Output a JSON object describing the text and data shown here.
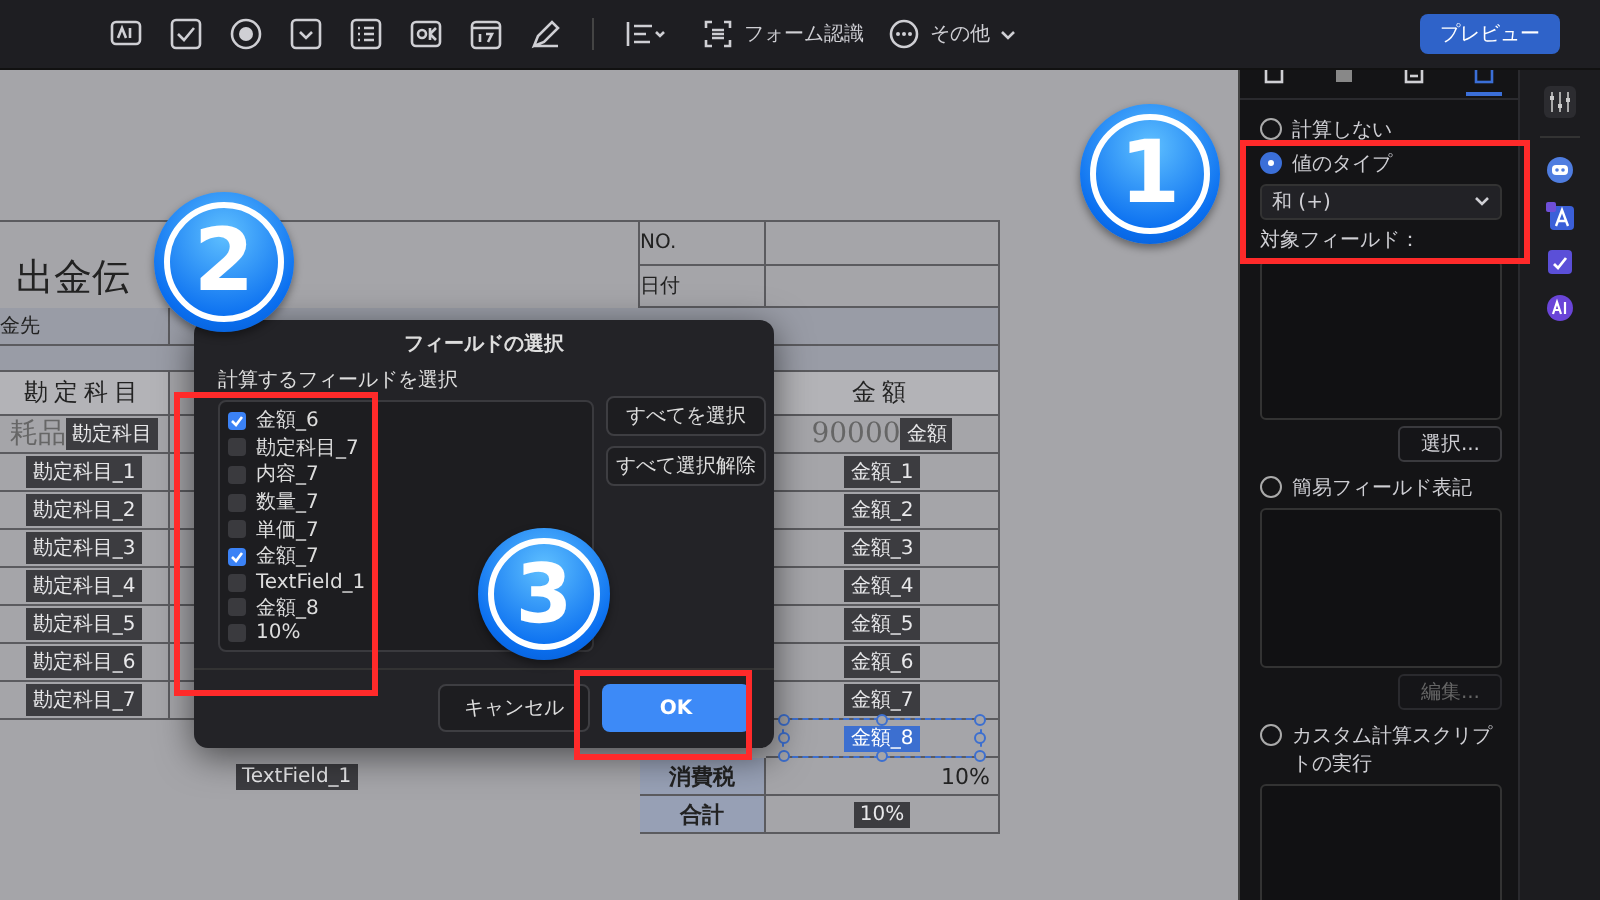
{
  "toolbar": {
    "items": [
      {
        "kind": "recognize",
        "label": "フォーム認識"
      },
      {
        "kind": "more",
        "label": "その他"
      }
    ],
    "preview_button": "プレビュー"
  },
  "document": {
    "title": "出金伝",
    "no_label": "NO.",
    "date_label": "日付",
    "payee_label": "金先",
    "header_account": "勘定科目",
    "header_amount": "金額",
    "entry_values": {
      "account": "耗品",
      "amount": "90000"
    },
    "rows": [
      {
        "account": "勘定科目",
        "amount": "金額"
      },
      {
        "account": "勘定科目_1",
        "amount": "金額_1"
      },
      {
        "account": "勘定科目_2",
        "amount": "金額_2"
      },
      {
        "account": "勘定科目_3",
        "amount": "金額_3"
      },
      {
        "account": "勘定科目_4",
        "amount": "金額_4"
      },
      {
        "account": "勘定科目_5",
        "amount": "金額_5"
      },
      {
        "account": "勘定科目_6",
        "amount": "金額_6"
      },
      {
        "account": "勘定科目_7",
        "amount": "金額_7"
      }
    ],
    "selected_field": {
      "label": "金額_8",
      "selected": true
    },
    "text_field": "TextField_1",
    "tax_label": "消費税",
    "tax_value": "10%",
    "total_label": "合計",
    "total_field": "10%"
  },
  "dialog": {
    "title": "フィールドの選択",
    "prompt": "計算するフィールドを選択",
    "fields": [
      {
        "label": "金額_6",
        "checked": true
      },
      {
        "label": "勘定科目_7",
        "checked": false
      },
      {
        "label": "内容_7",
        "checked": false
      },
      {
        "label": "数量_7",
        "checked": false
      },
      {
        "label": "単価_7",
        "checked": false
      },
      {
        "label": "金額_7",
        "checked": true
      },
      {
        "label": "TextField_1",
        "checked": false
      },
      {
        "label": "金額_8",
        "checked": false
      },
      {
        "label": "10%",
        "checked": false
      }
    ],
    "select_all": "すべてを選択",
    "deselect_all": "すべて選択解除",
    "cancel": "キャンセル",
    "ok": "OK"
  },
  "panel": {
    "tabs": [
      {
        "selected": false
      },
      {
        "selected": false
      },
      {
        "selected": false
      },
      {
        "selected": true
      }
    ],
    "sections": [
      {
        "kind": "none",
        "label": "計算しない",
        "selected": false
      },
      {
        "kind": "value",
        "label": "値のタイプ",
        "selected": true,
        "dropdown": "和 (+)",
        "field_label": "対象フィールド：",
        "button": {
          "label": "選択...",
          "disabled": false
        }
      },
      {
        "kind": "notation",
        "label": "簡易フィールド表記",
        "selected": false,
        "button": {
          "label": "編集...",
          "disabled": true
        }
      },
      {
        "kind": "script",
        "label": "カスタム計算スクリプトの実行",
        "selected": false
      }
    ]
  },
  "annotations": [
    {
      "label": "1"
    },
    {
      "label": "2"
    },
    {
      "label": "3"
    }
  ]
}
